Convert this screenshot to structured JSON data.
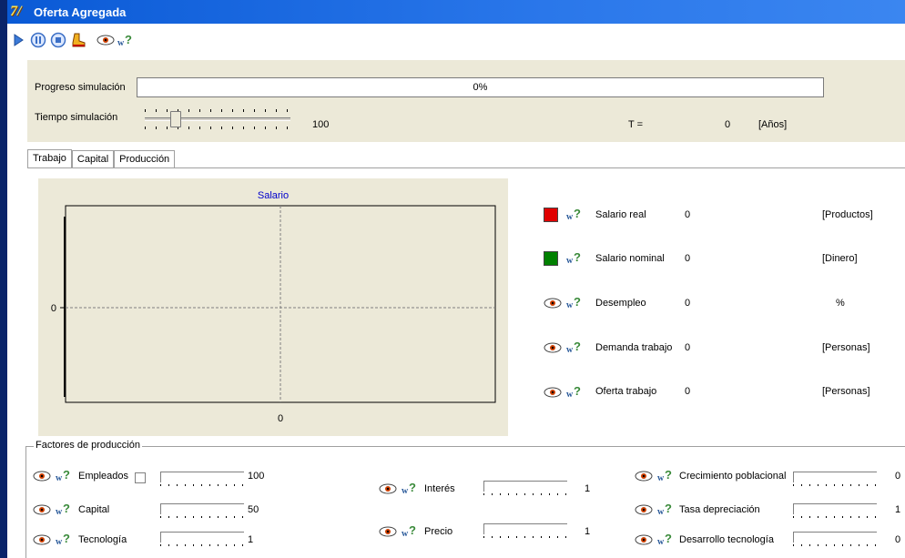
{
  "window": {
    "title": "Oferta Agregada"
  },
  "toolbar": {
    "buttons": [
      "play-icon",
      "pause-icon",
      "stop-icon",
      "boot-icon",
      "eye-icon",
      "help-icon"
    ]
  },
  "simulation": {
    "progress_label": "Progreso simulación",
    "progress_value": "0%",
    "progress_fraction": 0,
    "time_label": "Tiempo simulación",
    "time_value": "100",
    "t_label": "T =",
    "t_value": "0",
    "t_unit": "[Años]"
  },
  "tabs": [
    "Trabajo",
    "Capital",
    "Producción"
  ],
  "chart": {
    "title": "Salario",
    "y_tick": "0",
    "x_tick": "0",
    "colors": {
      "title": "#0000cc",
      "plot_bg": "#ece9d8"
    }
  },
  "chart_data": {
    "type": "line",
    "title": "Salario",
    "x": [
      0
    ],
    "series": [],
    "x_ticks": [
      "0"
    ],
    "y_ticks": [
      "0"
    ],
    "grid": true
  },
  "legend": [
    {
      "indicator": "swatch",
      "color": "#e00000",
      "name": "Salario real",
      "value": "0",
      "unit": "[Productos]"
    },
    {
      "indicator": "swatch",
      "color": "#008000",
      "name": "Salario nominal",
      "value": "0",
      "unit": "[Dinero]"
    },
    {
      "indicator": "eye",
      "name": "Desempleo",
      "value": "0",
      "unit": "%"
    },
    {
      "indicator": "eye",
      "name": "Demanda trabajo",
      "value": "0",
      "unit": "[Personas]"
    },
    {
      "indicator": "eye",
      "name": "Oferta trabajo",
      "value": "0",
      "unit": "[Personas]"
    }
  ],
  "factors": {
    "title": "Factores de producción",
    "col1": [
      {
        "name": "Empleados",
        "value": "100",
        "checkbox": true
      },
      {
        "name": "Capital",
        "value": "50"
      },
      {
        "name": "Tecnología",
        "value": "1"
      }
    ],
    "col2": [
      {
        "name": "Interés",
        "value": "1"
      },
      {
        "name": "Precio",
        "value": "1"
      }
    ],
    "col3": [
      {
        "name": "Crecimiento poblacional",
        "value": "0"
      },
      {
        "name": "Tasa depreciación",
        "value": "1"
      },
      {
        "name": "Desarrollo tecnología",
        "value": "0"
      }
    ]
  }
}
